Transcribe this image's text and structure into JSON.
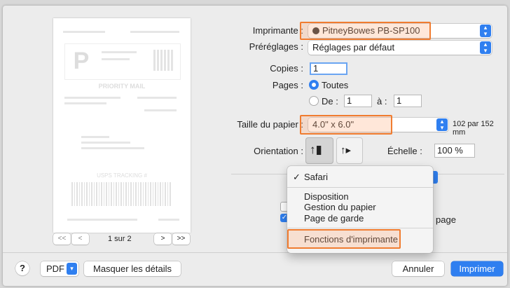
{
  "printer": {
    "label": "Imprimante :",
    "value": "PitneyBowes PB-SP100"
  },
  "presets": {
    "label": "Préréglages :",
    "value": "Réglages par défaut"
  },
  "copies": {
    "label": "Copies :",
    "value": "1"
  },
  "pages": {
    "label": "Pages :",
    "all_label": "Toutes",
    "range_from_label": "De :",
    "from_value": "1",
    "to_label": "à :",
    "to_value": "1"
  },
  "paper_size": {
    "label": "Taille du papier :",
    "value": "4.0\" x 6.0\"",
    "dimensions": "102 par 152 mm"
  },
  "orientation": {
    "label": "Orientation :"
  },
  "scale": {
    "label": "Échelle :",
    "value": "100 %"
  },
  "behind_menu": {
    "checkbox_text_fragment": "page"
  },
  "menu": {
    "checked_item": "Safari",
    "items": [
      "Disposition",
      "Gestion du papier",
      "Page de garde"
    ],
    "highlighted_item": "Fonctions d'imprimante"
  },
  "preview_nav": {
    "first_label": "<<",
    "prev_label": "<",
    "page_text": "1 sur 2",
    "next_label": ">",
    "last_label": ">>"
  },
  "preview": {
    "title_text": "PRIORITY MAIL",
    "big_letter": "P",
    "tracking_text": "USPS TRACKING #"
  },
  "footer": {
    "help_label": "?",
    "pdf_label": "PDF",
    "hide_details_label": "Masquer les détails",
    "cancel_label": "Annuler",
    "print_label": "Imprimer"
  },
  "colors": {
    "accent": "#2f7ff0",
    "highlight": "#f07c30"
  }
}
